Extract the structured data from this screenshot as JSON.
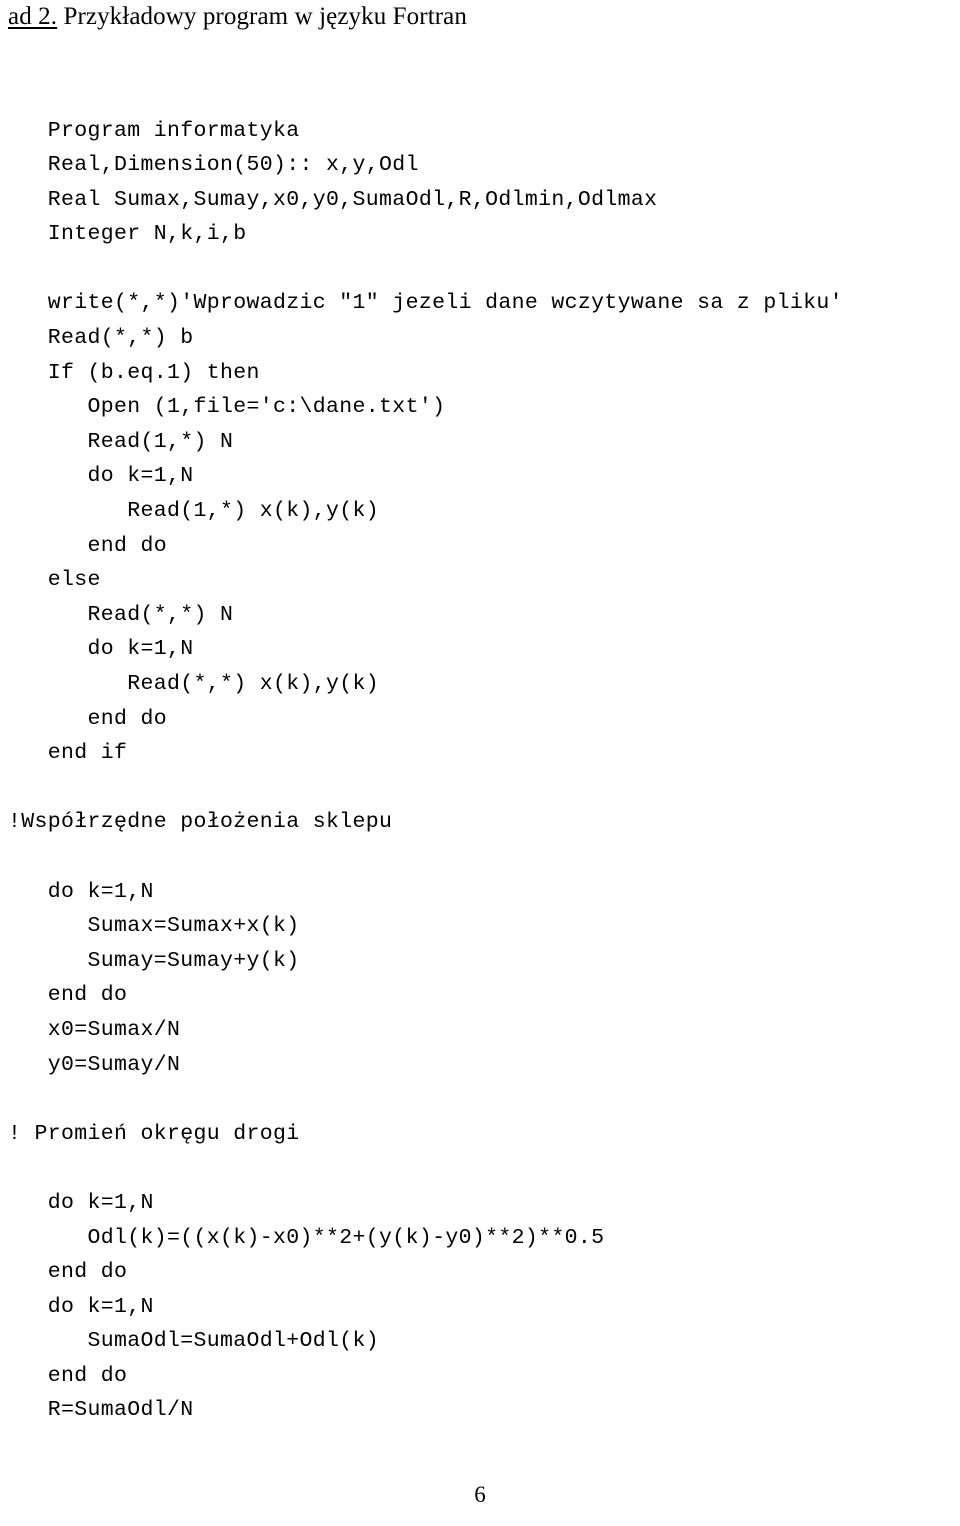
{
  "document": {
    "heading": {
      "underlined_prefix": "ad 2.",
      "rest": " Przykładowy program w języku Fortran"
    },
    "page_number": "6",
    "code_listing": {
      "language": "Fortran",
      "lines": [
        "   Program informatyka",
        "   Real,Dimension(50):: x,y,Odl",
        "   Real Sumax,Sumay,x0,y0,SumaOdl,R,Odlmin,Odlmax",
        "   Integer N,k,i,b",
        "",
        "   write(*,*)'Wprowadzic \"1\" jezeli dane wczytywane sa z pliku'",
        "   Read(*,*) b",
        "   If (b.eq.1) then",
        "      Open (1,file='c:\\dane.txt')",
        "      Read(1,*) N",
        "      do k=1,N",
        "         Read(1,*) x(k),y(k)",
        "      end do",
        "   else",
        "      Read(*,*) N",
        "      do k=1,N",
        "         Read(*,*) x(k),y(k)",
        "      end do",
        "   end if",
        "",
        "!Współrzędne położenia sklepu",
        "",
        "   do k=1,N",
        "      Sumax=Sumax+x(k)",
        "      Sumay=Sumay+y(k)",
        "   end do",
        "   x0=Sumax/N",
        "   y0=Sumay/N",
        "",
        "! Promień okręgu drogi",
        "",
        "   do k=1,N",
        "      Odl(k)=((x(k)-x0)**2+(y(k)-y0)**2)**0.5",
        "   end do",
        "   do k=1,N",
        "      SumaOdl=SumaOdl+Odl(k)",
        "   end do",
        "   R=SumaOdl/N"
      ]
    }
  }
}
